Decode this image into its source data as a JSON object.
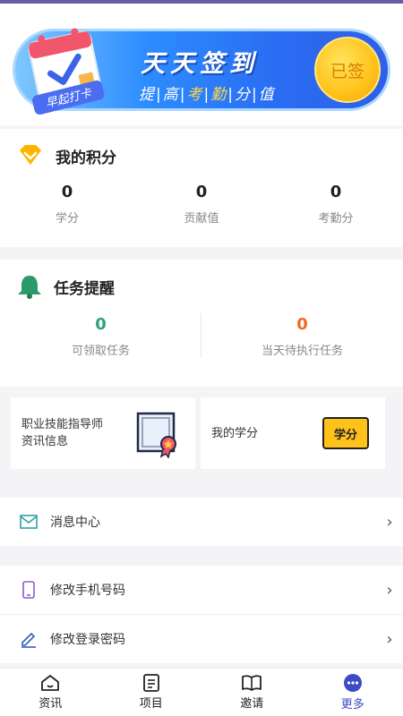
{
  "banner": {
    "title": "天天签到",
    "subtitle_parts": [
      "提",
      "|",
      "高",
      "|",
      "考",
      "|",
      "勤",
      "|",
      "分",
      "|",
      "值"
    ],
    "badge": "早起打卡",
    "signin_label": "已签"
  },
  "points": {
    "title": "我的积分",
    "stats": [
      {
        "value": "0",
        "label": "学分"
      },
      {
        "value": "0",
        "label": "贡献值"
      },
      {
        "value": "0",
        "label": "考勤分"
      }
    ]
  },
  "tasks": {
    "title": "任务提醒",
    "stats": [
      {
        "value": "0",
        "label": "可领取任务",
        "color": "#2fa07c"
      },
      {
        "value": "0",
        "label": "当天待执行任务",
        "color": "#f06a1e"
      }
    ]
  },
  "tiles": [
    {
      "label_line1": "职业技能指导师",
      "label_line2": "资讯信息",
      "icon": "certificate-icon"
    },
    {
      "label_line1": "我的学分",
      "label_line2": "",
      "icon": "credit-ticket-icon",
      "icon_text": "学分"
    }
  ],
  "list": [
    {
      "label": "消息中心",
      "icon": "mail-icon"
    },
    {
      "label": "修改手机号码",
      "icon": "phone-icon"
    },
    {
      "label": "修改登录密码",
      "icon": "edit-icon"
    }
  ],
  "nav": [
    {
      "label": "资讯",
      "icon": "home-icon",
      "active": false
    },
    {
      "label": "项目",
      "icon": "list-icon",
      "active": false
    },
    {
      "label": "邀请",
      "icon": "book-icon",
      "active": false
    },
    {
      "label": "更多",
      "icon": "more-icon",
      "active": true
    }
  ],
  "colors": {
    "accent": "#3b4cc4",
    "green": "#2fa07c",
    "orange": "#f06a1e",
    "gold": "#ffc21a"
  }
}
